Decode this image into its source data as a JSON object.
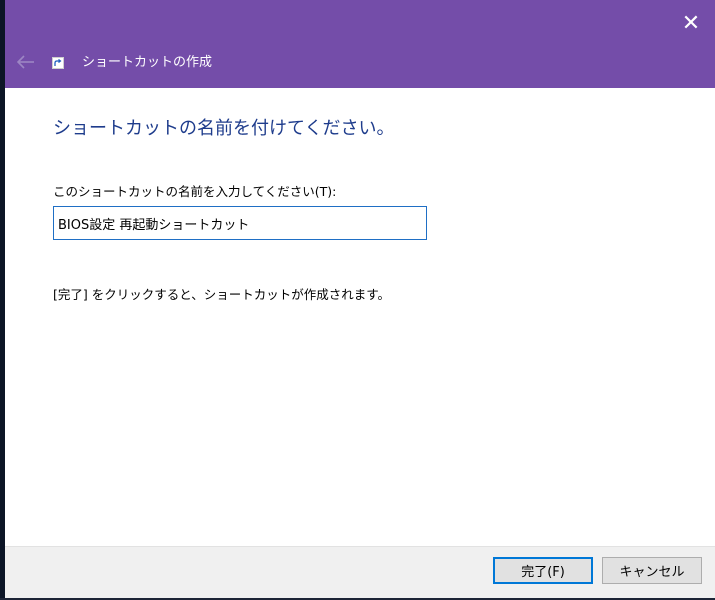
{
  "window": {
    "close_glyph": "✕",
    "accent_color": "#744da9"
  },
  "header": {
    "title": "ショートカットの作成",
    "back_icon": "back-arrow-icon"
  },
  "main": {
    "heading": "ショートカットの名前を付けてください。",
    "field_label": "このショートカットの名前を入力してください(T):",
    "name_value": "BIOS設定 再起動ショートカット",
    "instruction": "[完了] をクリックすると、ショートカットが作成されます。"
  },
  "footer": {
    "finish_label": "完了(F)",
    "cancel_label": "キャンセル"
  }
}
